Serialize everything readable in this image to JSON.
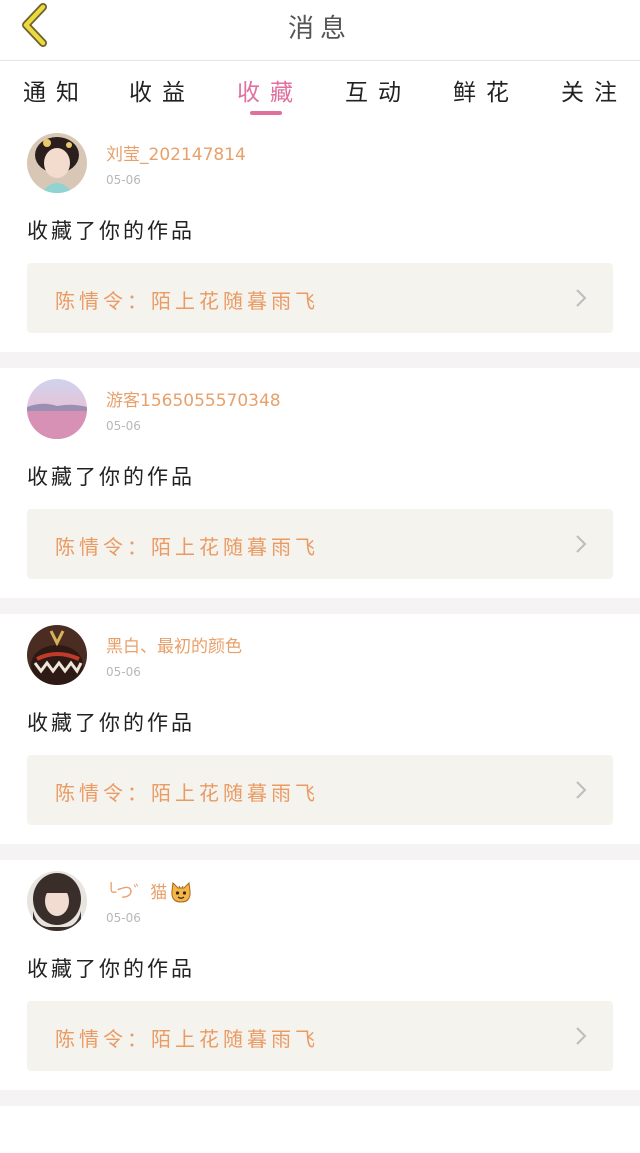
{
  "header": {
    "title": "消息",
    "back_icon": "chevron-left-icon",
    "back_color": "#e6d23c"
  },
  "tabs": [
    {
      "label": "通知",
      "active": false
    },
    {
      "label": "收益",
      "active": false
    },
    {
      "label": "收藏",
      "active": true
    },
    {
      "label": "互动",
      "active": false
    },
    {
      "label": "鲜花",
      "active": false
    },
    {
      "label": "关注",
      "active": false
    }
  ],
  "colors": {
    "accent": "#e0709d",
    "username": "#e8a06a",
    "work_title": "#eb9a63",
    "work_box_bg": "#f4f3ee"
  },
  "items": [
    {
      "user": "刘莹_202147814",
      "time": "05-06",
      "action": "收藏了你的作品",
      "work": "陈情令：陌上花随暮雨飞",
      "avatar": "avatar-girl-costume"
    },
    {
      "user": "游客1565055570348",
      "time": "05-06",
      "action": "收藏了你的作品",
      "work": "陈情令：陌上花随暮雨飞",
      "avatar": "avatar-lake-sunset"
    },
    {
      "user": "黑白、最初的颜色",
      "time": "05-06",
      "action": "收藏了你的作品",
      "work": "陈情令：陌上花随暮雨飞",
      "avatar": "avatar-shark-hoodie"
    },
    {
      "user": "╰つ゛猫",
      "user_icon": "cat-emoji-icon",
      "time": "05-06",
      "action": "收藏了你的作品",
      "work": "陈情令：陌上花随暮雨飞",
      "avatar": "avatar-girl-portrait"
    }
  ]
}
